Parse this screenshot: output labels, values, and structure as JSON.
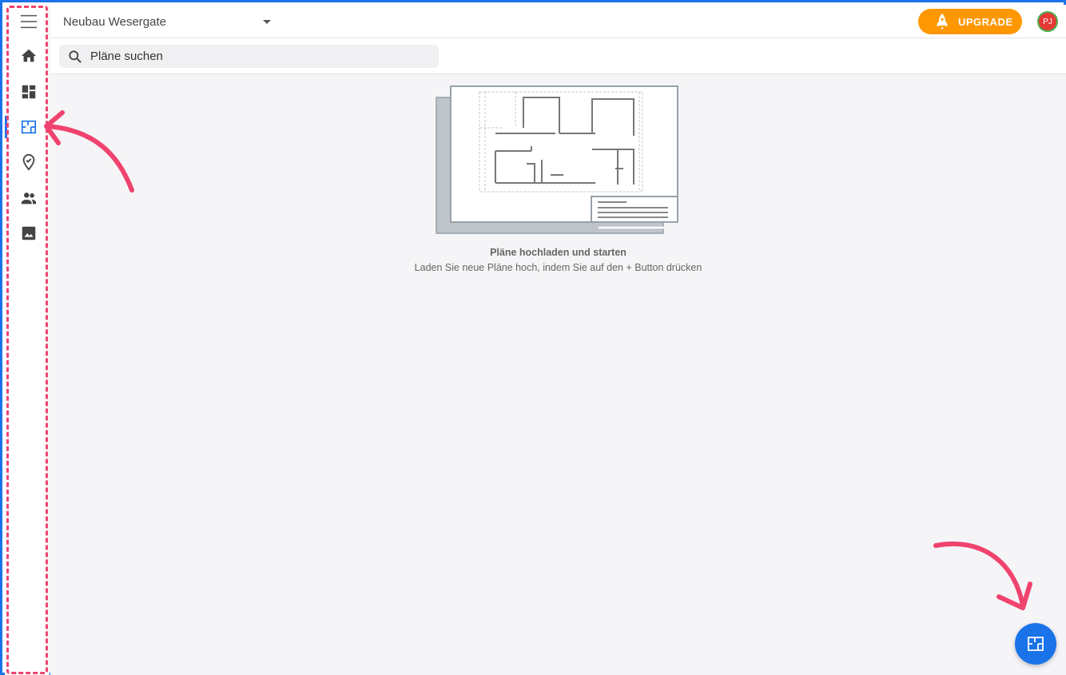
{
  "header": {
    "project_name": "Neubau Wesergate",
    "upgrade_label": "UPGRADE",
    "avatar_initials": "PJ"
  },
  "search": {
    "placeholder": "Pläne suchen"
  },
  "sidebar": {
    "items": [
      {
        "icon": "menu-icon"
      },
      {
        "icon": "home-icon"
      },
      {
        "icon": "dashboard-icon"
      },
      {
        "icon": "plans-icon",
        "active": true
      },
      {
        "icon": "task-pin-icon"
      },
      {
        "icon": "people-icon"
      },
      {
        "icon": "image-icon"
      }
    ]
  },
  "empty_state": {
    "title": "Pläne hochladen und starten",
    "subtitle": "Laden Sie neue Pläne hoch, indem Sie auf den + Button drücken"
  },
  "fab": {
    "icon": "plans-icon"
  },
  "colors": {
    "accent": "#1a73e8",
    "upgrade": "#ff9800",
    "annotation": "#f0446e",
    "background": "#f5f5f8"
  }
}
